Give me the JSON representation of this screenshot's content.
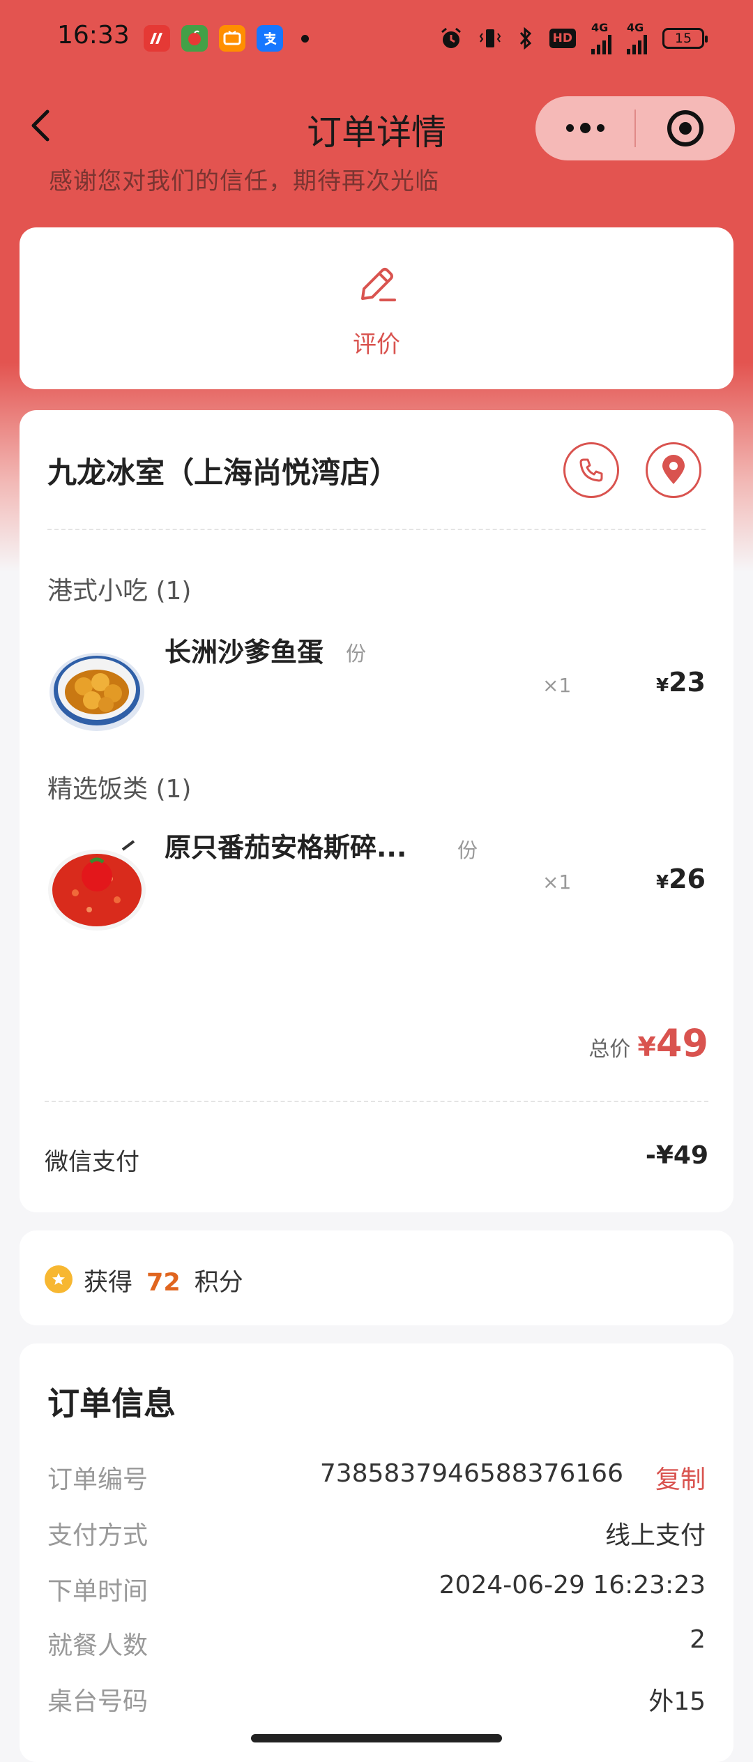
{
  "status_bar": {
    "time": "16:33",
    "apps": [
      {
        "icon": "news-app-icon",
        "glyph": "⁖",
        "color": "#e53935"
      },
      {
        "icon": "melon-app-icon",
        "glyph": "●",
        "color": "#43a047"
      },
      {
        "icon": "mango-tv-icon",
        "glyph": "tv",
        "color": "#ff8f00"
      },
      {
        "icon": "alipay-icon",
        "glyph": "支",
        "color": "#1677ff"
      }
    ],
    "network_1": "4G",
    "network_2": "4G",
    "hd": "HD",
    "battery": "15"
  },
  "nav": {
    "title": "订单详情"
  },
  "thanks_text": "感谢您对我们的信任，期待再次光临",
  "review": {
    "label": "评价"
  },
  "order": {
    "store_name": "九龙冰室（上海尚悦湾店）",
    "categories": [
      {
        "name": "港式小吃 (1)",
        "dishes": [
          {
            "name": "长洲沙爹鱼蛋",
            "unit": "份",
            "qty": "×1",
            "currency": "¥",
            "price": "23"
          }
        ]
      },
      {
        "name": "精选饭类 (1)",
        "dishes": [
          {
            "name": "原只番茄安格斯碎...",
            "unit": "份",
            "qty": "×1",
            "currency": "¥",
            "price": "26"
          }
        ]
      }
    ],
    "total_label": "总价",
    "total_currency": "¥",
    "total_value": "49",
    "payment_label": "微信支付",
    "payment_value": "-¥49"
  },
  "points": {
    "prefix": "获得",
    "amount": "72",
    "suffix": "积分"
  },
  "info": {
    "title": "订单信息",
    "copy_label": "复制",
    "rows": [
      {
        "label": "订单编号",
        "value": "7385837946588376166"
      },
      {
        "label": "支付方式",
        "value": "线上支付"
      },
      {
        "label": "下单时间",
        "value": "2024-06-29 16:23:23"
      },
      {
        "label": "就餐人数",
        "value": "2"
      },
      {
        "label": "桌台号码",
        "value": "外15"
      }
    ]
  },
  "colors": {
    "brand_red": "#e35450",
    "accent_red": "#d9534f",
    "points_orange": "#e0651f"
  }
}
